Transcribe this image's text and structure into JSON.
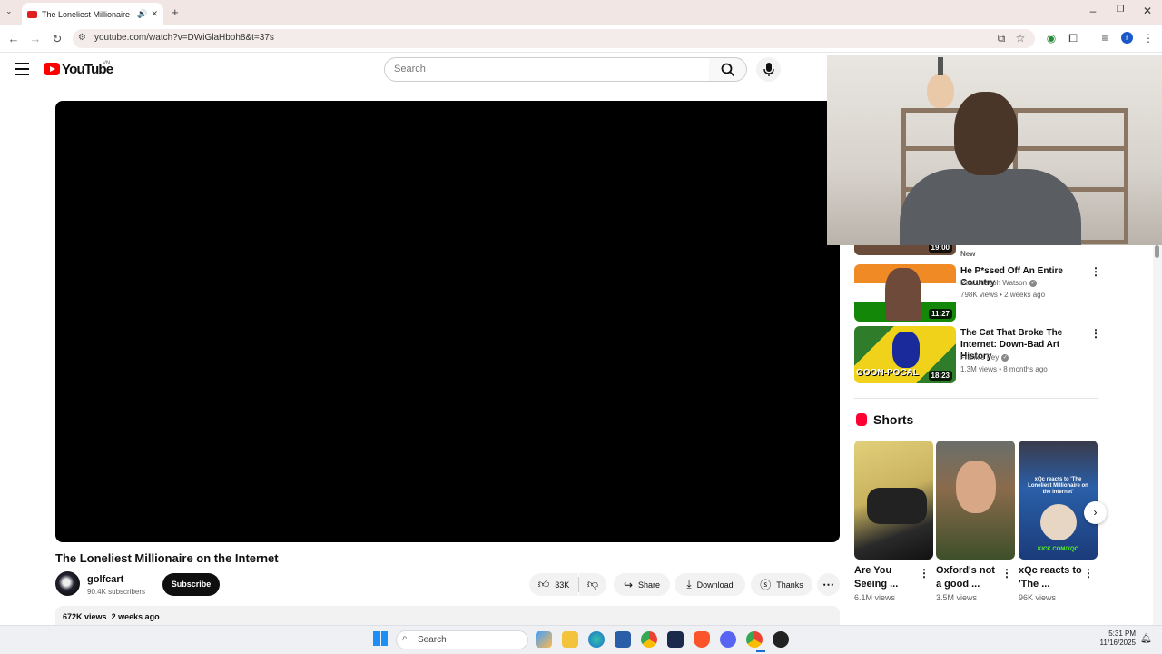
{
  "browser": {
    "tab_title": "The Loneliest Millionaire on the Internet",
    "url": "youtube.com/watch?v=DWiGlaHboh8&t=37s"
  },
  "youtube": {
    "logo_text": "YouTube",
    "country_code": "VN",
    "search_placeholder": "Search"
  },
  "video": {
    "title": "The Loneliest Millionaire on the Internet",
    "channel": "golfcart",
    "subscribers": "90.4K subscribers",
    "subscribe_label": "Subscribe",
    "likes": "33K",
    "share_label": "Share",
    "download_label": "Download",
    "thanks_label": "Thanks",
    "views": "672K views",
    "age": "2 weeks ago"
  },
  "sidebar": {
    "partial_duration": "19:00",
    "partial_badge": "New",
    "recommendations": [
      {
        "title": "He P*ssed Off An Entire Country",
        "channel": "Paul Joseph Watson",
        "meta": "798K views • 2 weeks ago",
        "duration": "11:27"
      },
      {
        "title": "The Cat That Broke The Internet: Down-Bad Art History",
        "channel": "Frankie Fey",
        "meta": "1.3M views • 8 months ago",
        "duration": "18:23",
        "thumb_text": "GOON-POCAL"
      }
    ],
    "shorts_heading": "Shorts",
    "shorts": [
      {
        "title": "Are You Seeing ...",
        "views": "6.1M views"
      },
      {
        "title": "Oxford's not a good ...",
        "views": "3.5M views"
      },
      {
        "title": "xQc reacts to 'The ...",
        "views": "96K views",
        "thumb_text": "xQc reacts to 'The Loneliest Millionaire on the Internet'",
        "thumb_footer": "KICK.COM/XQC"
      }
    ]
  },
  "taskbar": {
    "search_label": "Search",
    "time": "5:31 PM",
    "date": "11/16/2025"
  }
}
